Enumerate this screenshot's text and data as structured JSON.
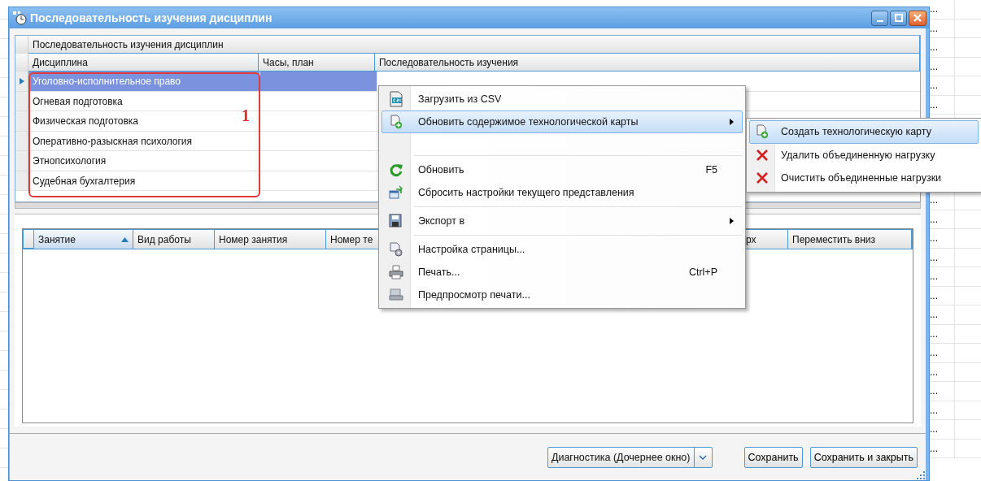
{
  "window": {
    "title": "Последовательность изучения дисциплин"
  },
  "top_grid": {
    "band": "Последовательность изучения дисциплин",
    "columns": [
      "Дисциплина",
      "Часы, план",
      "Последовательность изучения"
    ],
    "rows": [
      {
        "discipline": "Уголовно-исполнительное право",
        "selected": true
      },
      {
        "discipline": "Огневая подготовка",
        "selected": false
      },
      {
        "discipline": "Физическая подготовка",
        "selected": false
      },
      {
        "discipline": "Оперативно-разыскная психология",
        "selected": false
      },
      {
        "discipline": "Этнопсихология",
        "selected": false
      },
      {
        "discipline": "Судебная бухгалтерия",
        "selected": false
      }
    ]
  },
  "annotation": {
    "label": "1"
  },
  "bottom_grid": {
    "columns": [
      {
        "label": "Занятие",
        "sorted": true
      },
      {
        "label": "Вид работы",
        "sorted": false
      },
      {
        "label": "Номер занятия",
        "sorted": false
      },
      {
        "label": "Номер те",
        "sorted": false
      },
      {
        "label": "рх",
        "sorted": false
      },
      {
        "label": "Переместить вниз",
        "sorted": false
      }
    ]
  },
  "context_menu": {
    "items": [
      {
        "kind": "item",
        "label": "Загрузить из CSV",
        "selected": false,
        "submenu": false
      },
      {
        "kind": "item",
        "label": "Обновить содержимое технологической карты",
        "selected": true,
        "submenu": true
      },
      {
        "kind": "blank"
      },
      {
        "kind": "separator"
      },
      {
        "kind": "item",
        "label": "Обновить",
        "shortcut": "F5",
        "selected": false,
        "submenu": false
      },
      {
        "kind": "item",
        "label": "Сбросить настройки текущего представления",
        "selected": false,
        "submenu": false
      },
      {
        "kind": "separator"
      },
      {
        "kind": "item",
        "label": "Экспорт в",
        "selected": false,
        "submenu": true
      },
      {
        "kind": "separator"
      },
      {
        "kind": "item",
        "label": "Настройка страницы...",
        "selected": false,
        "submenu": false
      },
      {
        "kind": "item",
        "label": "Печать...",
        "shortcut": "Ctrl+P",
        "selected": false,
        "submenu": false
      },
      {
        "kind": "item",
        "label": "Предпросмотр печати...",
        "selected": false,
        "submenu": false
      }
    ]
  },
  "submenu": {
    "items": [
      {
        "kind": "add",
        "label": "Создать технологическую карту",
        "selected": true
      },
      {
        "kind": "remove",
        "label": "Удалить объединенную нагрузку",
        "selected": false
      },
      {
        "kind": "remove",
        "label": "Очистить объединенные нагрузки",
        "selected": false
      }
    ]
  },
  "footer": {
    "split_button": "Диагностика (Дочернее окно)",
    "buttons": [
      "Сохранить",
      "Сохранить и закрыть"
    ]
  },
  "background_sheet": {
    "cells": [
      "...",
      "...",
      "...",
      "...",
      "...",
      "...",
      "...",
      "...",
      "...",
      "...",
      "...",
      "...",
      "...",
      "...",
      "...",
      "...",
      "...",
      "...",
      "...",
      "..."
    ]
  }
}
